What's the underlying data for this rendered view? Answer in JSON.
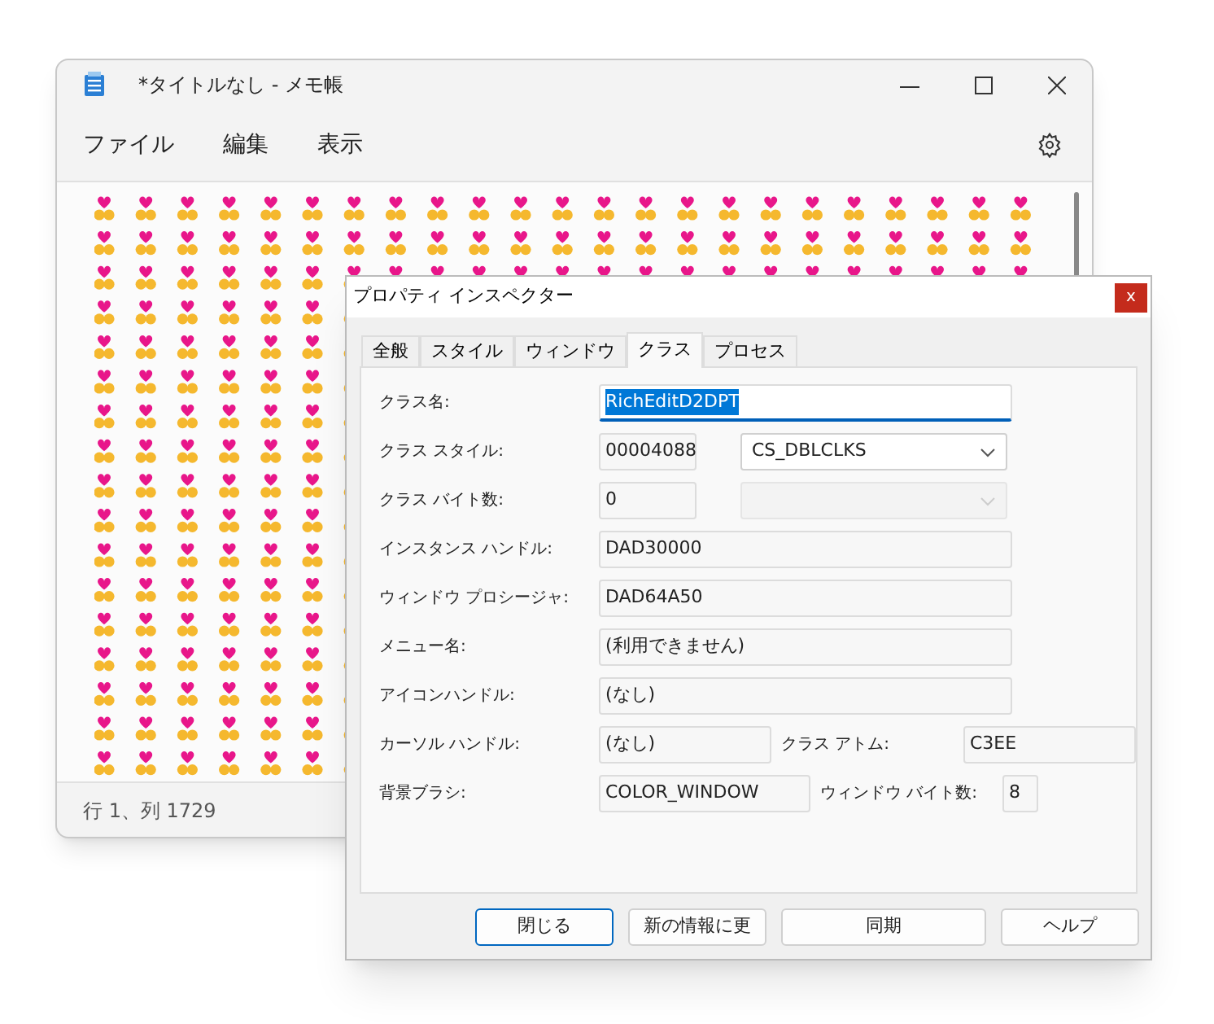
{
  "notepad": {
    "title": "*タイトルなし - メモ帳",
    "menu": [
      "ファイル",
      "編集",
      "表示"
    ],
    "status_bar": "行 1、列 1729"
  },
  "dialog": {
    "title": "プロパティ インスペクター",
    "close": "x",
    "tabs": [
      {
        "label": "全般",
        "selected": false
      },
      {
        "label": "スタイル",
        "selected": false
      },
      {
        "label": "ウィンドウ",
        "selected": false
      },
      {
        "label": "クラス",
        "selected": true
      },
      {
        "label": "プロセス",
        "selected": false
      }
    ],
    "rows": [
      {
        "label": "クラス名:",
        "value": "RichEditD2DPT",
        "kind": "wide",
        "highlighted": true
      },
      {
        "label": "クラス スタイル:",
        "value": "00004088",
        "kind": "short",
        "combo": {
          "value": "CS_DBLCLKS",
          "disabled": false
        }
      },
      {
        "label": "クラス バイト数:",
        "value": "0",
        "kind": "short",
        "combo": {
          "disabled": true
        }
      },
      {
        "label": "インスタンス ハンドル:",
        "value": "DAD30000",
        "kind": "wide"
      },
      {
        "label": "ウィンドウ プロシージャ:",
        "value": "DAD64A50",
        "kind": "wide"
      },
      {
        "label": "メニュー名:",
        "value": "(利用できません)",
        "kind": "wide"
      },
      {
        "label": "アイコンハンドル:",
        "value": "(なし)",
        "kind": "wide"
      },
      {
        "label": "カーソル ハンドル:",
        "value": "(なし)",
        "kind": "medium",
        "pair": {
          "label": "クラス アトム:",
          "value": "C3EE",
          "kind": "medium"
        }
      },
      {
        "label": "背景ブラシ:",
        "value": "COLOR_WINDOW",
        "kind": "medium",
        "pair": {
          "label": "ウィンドウ バイト数:",
          "value": "8",
          "kind": "tiny"
        }
      }
    ],
    "buttons": [
      {
        "label": "閉じる",
        "default": true
      },
      {
        "label": "新の情報に更",
        "default": false
      },
      {
        "label": "同期",
        "default": false
      },
      {
        "label": "ヘルプ",
        "default": false
      }
    ]
  }
}
